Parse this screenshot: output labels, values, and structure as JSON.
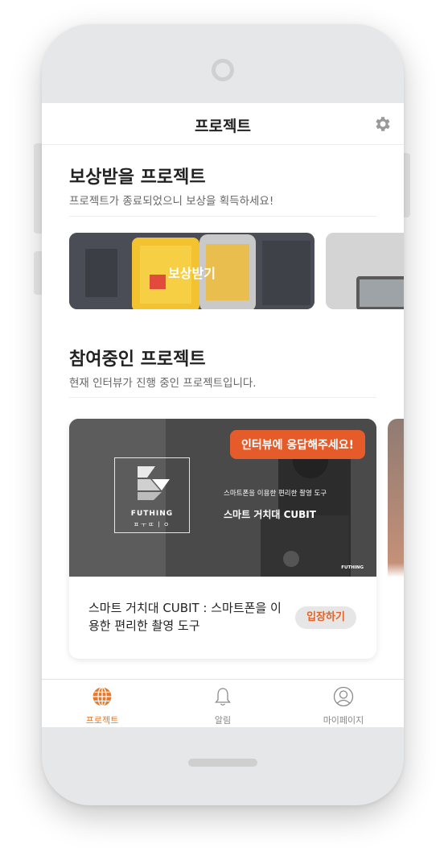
{
  "header": {
    "title": "프로젝트",
    "settings_icon": "gear-icon"
  },
  "reward_section": {
    "title": "보상받을 프로젝트",
    "subtitle": "프로젝트가 종료되었으니 보상을 획득하세요!",
    "card_label": "보상받기"
  },
  "participating_section": {
    "title": "참여중인 프로젝트",
    "subtitle": "현재 인터뷰가 진행 중인 프로젝트입니다.",
    "card": {
      "badge": "인터뷰에 응답해주세요!",
      "image_logo": "FUTHING",
      "image_logo_sub": "ㅍㅜㄸㅣㅇ",
      "image_tagline": "스마트폰을 이용한 편리한 촬영 도구",
      "image_name": "스마트 거치대 CUBIT",
      "corner_mark": "FUTHING",
      "title": "스마트 거치대 CUBIT : 스마트폰을 이용한 편리한 촬영 도구",
      "button": "입장하기"
    }
  },
  "bottom_nav": {
    "items": [
      {
        "label": "프로젝트",
        "icon": "globe-icon",
        "active": true
      },
      {
        "label": "알림",
        "icon": "bell-icon",
        "active": false
      },
      {
        "label": "마이페이지",
        "icon": "user-icon",
        "active": false
      }
    ]
  },
  "colors": {
    "accent": "#e5792d",
    "badge": "#e55b2a"
  }
}
